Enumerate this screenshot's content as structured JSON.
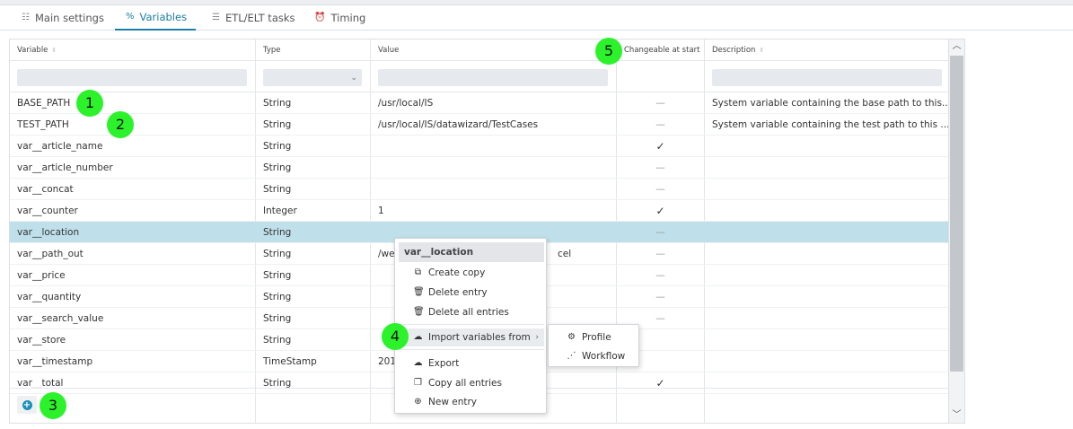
{
  "tabs": [
    {
      "label": "Main settings",
      "icon": "list-icon"
    },
    {
      "label": "Variables",
      "icon": "percent-icon",
      "active": true
    },
    {
      "label": "ETL/ELT tasks",
      "icon": "tasks-icon"
    },
    {
      "label": "Timing",
      "icon": "alarm-icon"
    }
  ],
  "grid": {
    "columns": [
      "Variable",
      "Type",
      "Value",
      "Changeable at start",
      "Description"
    ],
    "rows": [
      {
        "variable": "BASE_PATH",
        "type": "String",
        "value": "/usr/local/IS",
        "changeable": "—",
        "description": "System variable containing the base path to this..."
      },
      {
        "variable": "TEST_PATH",
        "type": "String",
        "value": "/usr/local/IS/datawizard/TestCases",
        "changeable": "—",
        "description": "System variable containing the test path to this ..."
      },
      {
        "variable": "var__article_name",
        "type": "String",
        "value": "",
        "changeable": "✓",
        "description": ""
      },
      {
        "variable": "var__article_number",
        "type": "String",
        "value": "",
        "changeable": "—",
        "description": ""
      },
      {
        "variable": "var__concat",
        "type": "String",
        "value": "",
        "changeable": "—",
        "description": ""
      },
      {
        "variable": "var__counter",
        "type": "Integer",
        "value": "1",
        "changeable": "✓",
        "description": ""
      },
      {
        "variable": "var__location",
        "type": "String",
        "value": "",
        "changeable": "—",
        "description": "",
        "selected": true
      },
      {
        "variable": "var__path_out",
        "type": "String",
        "value": "/we",
        "value_tail": "cel",
        "changeable": "—",
        "description": ""
      },
      {
        "variable": "var__price",
        "type": "String",
        "value": "",
        "changeable": "—",
        "description": ""
      },
      {
        "variable": "var__quantity",
        "type": "String",
        "value": "",
        "changeable": "—",
        "description": ""
      },
      {
        "variable": "var__search_value",
        "type": "String",
        "value": "",
        "changeable": "—",
        "description": ""
      },
      {
        "variable": "var__store",
        "type": "String",
        "value": "",
        "changeable": "",
        "description": ""
      },
      {
        "variable": "var__timestamp",
        "type": "TimeStamp",
        "value": "201",
        "changeable": "",
        "description": ""
      },
      {
        "variable": "var__total",
        "type": "String",
        "value": "",
        "changeable": "✓",
        "description": ""
      }
    ]
  },
  "context_menu": {
    "title": "var__location",
    "items": [
      {
        "label": "Create copy",
        "icon": "copy-icon"
      },
      {
        "label": "Delete entry",
        "icon": "trash-icon"
      },
      {
        "label": "Delete all entries",
        "icon": "trash-all-icon"
      },
      {
        "label": "Import variables from",
        "icon": "cloud-import-icon",
        "submenu": true
      },
      {
        "label": "Export",
        "icon": "cloud-export-icon"
      },
      {
        "label": "Copy all entries",
        "icon": "copy-all-icon"
      },
      {
        "label": "New entry",
        "icon": "plus-circle-icon"
      }
    ]
  },
  "submenu": {
    "items": [
      {
        "label": "Profile",
        "icon": "chip-icon"
      },
      {
        "label": "Workflow",
        "icon": "workflow-icon"
      }
    ]
  },
  "badges": [
    "1",
    "2",
    "3",
    "4",
    "5"
  ],
  "colors": {
    "accent": "#1a7fa4",
    "selected_row": "#bfe0ea",
    "badge": "#2cf22c"
  }
}
